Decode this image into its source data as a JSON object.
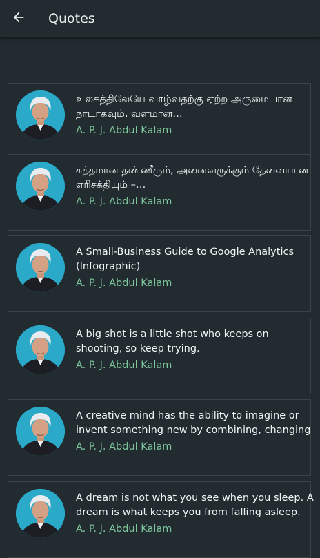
{
  "appbar": {
    "title": "Quotes",
    "back_icon": "arrow-left-icon"
  },
  "colors": {
    "background": "#222b30",
    "title_text": "#eceff1",
    "quote_text": "#f1f4f5",
    "author_text": "#7fc59b",
    "card_border": "#3b4448"
  },
  "quotes": [
    {
      "text": " உலகத்திலேயே வாழ்வதற்கு ஏற்ற அருமையான நாடாகவும், வளமான…",
      "author": "A. P. J. Abdul Kalam"
    },
    {
      "text": " சுத்தமான தண்ணீரும், அனைவருக்கும் தேவையான எரிசக்தியும் –…",
      "author": "A. P. J. Abdul Kalam"
    },
    {
      "text": "A Small-Business Guide to Google Analytics (Infographic)",
      "author": "A. P. J. Abdul Kalam"
    },
    {
      "text": "A big shot is a little shot who keeps on shooting, so keep trying.",
      "author": "A. P. J. Abdul Kalam"
    },
    {
      "text": "A creative mind has the ability to imagine or invent something new by combining, changing or…",
      "author": "A. P. J. Abdul Kalam"
    },
    {
      "text": "A dream is not what you see when you sleep. A dream is what keeps you from falling asleep.",
      "author": "A. P. J. Abdul Kalam"
    }
  ]
}
